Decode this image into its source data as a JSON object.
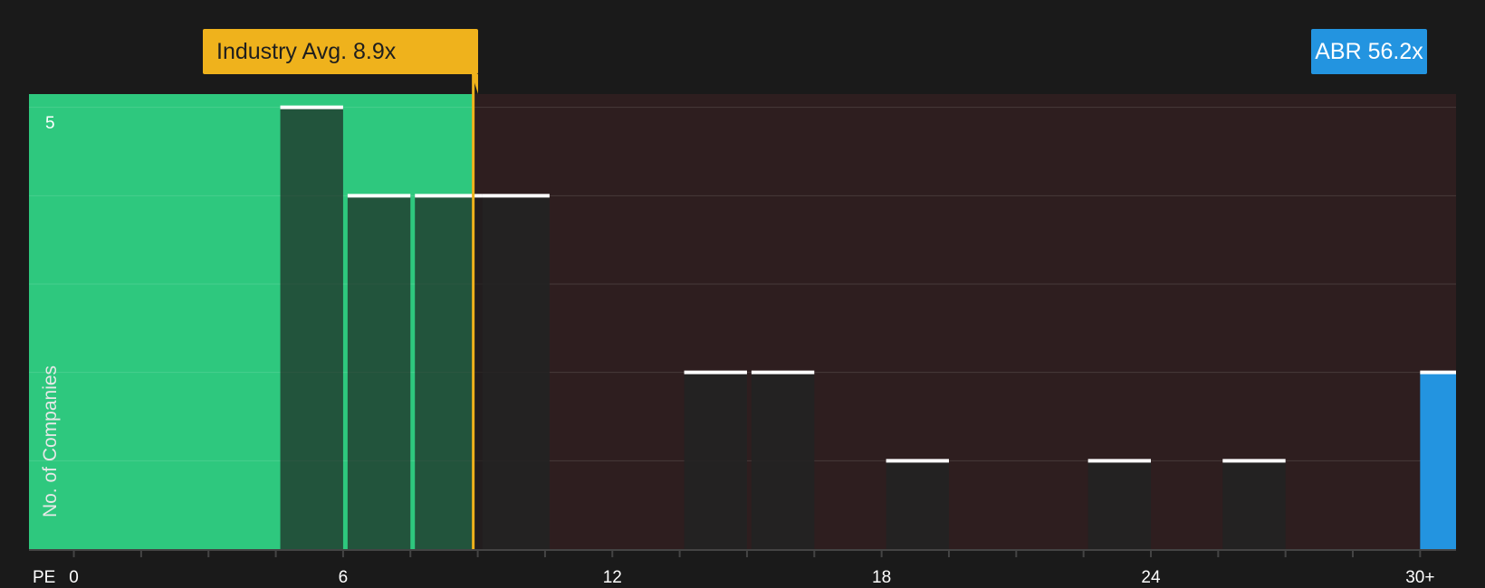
{
  "chart_data": {
    "type": "bar",
    "xlabel": "PE",
    "ylabel": "No. of Companies",
    "x_ticks": [
      "0",
      "6",
      "12",
      "18",
      "24",
      "30+"
    ],
    "x_tick_values": [
      0,
      6,
      12,
      18,
      24,
      30
    ],
    "xlim": [
      -1,
      30.8
    ],
    "y_max_label": "5",
    "ylim": [
      0,
      5.15
    ],
    "bars": [
      {
        "x0": 4.6,
        "x1": 6.0,
        "value": 5
      },
      {
        "x0": 6.1,
        "x1": 7.5,
        "value": 4
      },
      {
        "x0": 7.6,
        "x1": 9.1,
        "value": 4
      },
      {
        "x0": 9.1,
        "x1": 10.6,
        "value": 4
      },
      {
        "x0": 13.6,
        "x1": 15.0,
        "value": 2
      },
      {
        "x0": 15.1,
        "x1": 16.5,
        "value": 2
      },
      {
        "x0": 18.1,
        "x1": 19.5,
        "value": 1
      },
      {
        "x0": 22.6,
        "x1": 24.0,
        "value": 1
      },
      {
        "x0": 25.6,
        "x1": 27.0,
        "value": 1
      }
    ],
    "company_bar": {
      "x0": 30.0,
      "x1": 30.8,
      "value": 2
    },
    "industry_avg": 8.9,
    "company_pe": 56.2,
    "grid": true
  },
  "labels": {
    "industry_badge": "Industry Avg. 8.9x",
    "company_badge": "ABR 56.2x"
  },
  "colors": {
    "background": "#1a1a1a",
    "undervalued_region": "#2ec87e",
    "overvalued_region": "#2e1e1f",
    "bar": "#222222",
    "bar_top": "#ffffff",
    "industry": "#efb21c",
    "company": "#2394e0",
    "axis": "#444444"
  }
}
